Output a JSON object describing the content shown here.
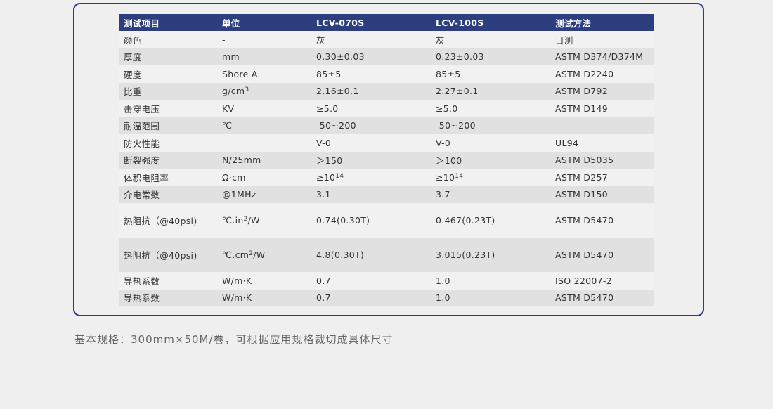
{
  "table": {
    "headers": [
      "测试项目",
      "单位",
      "LCV-070S",
      "LCV-100S",
      "测试方法"
    ],
    "rows": [
      {
        "item": "颜色",
        "unit": "-",
        "u_base": "",
        "u_sup": "",
        "u_tail": "",
        "v070": "灰",
        "v070_sup": "",
        "v100": "灰",
        "v100_sup": "",
        "method": "目测"
      },
      {
        "item": "厚度",
        "unit": "mm",
        "u_base": "",
        "u_sup": "",
        "u_tail": "",
        "v070": "0.30±0.03",
        "v070_sup": "",
        "v100": "0.23±0.03",
        "v100_sup": "",
        "method": "ASTM D374/D374M"
      },
      {
        "item": "硬度",
        "unit": "Shore A",
        "u_base": "",
        "u_sup": "",
        "u_tail": "",
        "v070": "85±5",
        "v070_sup": "",
        "v100": "85±5",
        "v100_sup": "",
        "method": "ASTM D2240"
      },
      {
        "item": "比重",
        "unit": "",
        "u_base": "g/cm",
        "u_sup": "3",
        "u_tail": "",
        "v070": "2.16±0.1",
        "v070_sup": "",
        "v100": "2.27±0.1",
        "v100_sup": "",
        "method": "ASTM D792"
      },
      {
        "item": "击穿电压",
        "unit": "KV",
        "u_base": "",
        "u_sup": "",
        "u_tail": "",
        "v070": "≥5.0",
        "v070_sup": "",
        "v100": "≥5.0",
        "v100_sup": "",
        "method": "ASTM D149"
      },
      {
        "item": "耐温范围",
        "unit": "℃",
        "u_base": "",
        "u_sup": "",
        "u_tail": "",
        "v070": "-50~200",
        "v070_sup": "",
        "v100": "-50~200",
        "v100_sup": "",
        "method": "-"
      },
      {
        "item": "防火性能",
        "unit": "",
        "u_base": "",
        "u_sup": "",
        "u_tail": "",
        "v070": "V-0",
        "v070_sup": "",
        "v100": "V-0",
        "v100_sup": "",
        "method": "UL94"
      },
      {
        "item": "断裂强度",
        "unit": "N/25mm",
        "u_base": "",
        "u_sup": "",
        "u_tail": "",
        "v070": "＞150",
        "v070_sup": "",
        "v100": "＞100",
        "v100_sup": "",
        "method": "ASTM D5035"
      },
      {
        "item": "体积电阻率",
        "unit": "Ω·cm",
        "u_base": "",
        "u_sup": "",
        "u_tail": "",
        "v070": "≥10",
        "v070_sup": "14",
        "v100": "≥10",
        "v100_sup": "14",
        "method": "ASTM D257"
      },
      {
        "item": "介电常数",
        "unit": "@1MHz",
        "u_base": "",
        "u_sup": "",
        "u_tail": "",
        "v070": "3.1",
        "v070_sup": "",
        "v100": "3.7",
        "v100_sup": "",
        "method": "ASTM D150"
      },
      {
        "item": "热阻抗（@40psi)",
        "unit": "",
        "u_base": "℃.in",
        "u_sup": "2",
        "u_tail": "/W",
        "v070": "0.74(0.30T)",
        "v070_sup": "",
        "v100": "0.467(0.23T)",
        "v100_sup": "",
        "method": "ASTM D5470"
      },
      {
        "item": "热阻抗（@40psi)",
        "unit": "",
        "u_base": "℃.cm",
        "u_sup": "2",
        "u_tail": "/W",
        "v070": "4.8(0.30T)",
        "v070_sup": "",
        "v100": "3.015(0.23T)",
        "v100_sup": "",
        "method": "ASTM D5470"
      },
      {
        "item": "导热系数",
        "unit": "W/m·K",
        "u_base": "",
        "u_sup": "",
        "u_tail": "",
        "v070": "0.7",
        "v070_sup": "",
        "v100": "1.0",
        "v100_sup": "",
        "method": "ISO 22007-2"
      },
      {
        "item": "导热系数",
        "unit": "W/m·K",
        "u_base": "",
        "u_sup": "",
        "u_tail": "",
        "v070": "0.7",
        "v070_sup": "",
        "v100": "1.0",
        "v100_sup": "",
        "method": "ASTM D5470"
      }
    ]
  },
  "footnote": "基本规格：300mm×50M/卷，可根据应用规格裁切成具体尺寸",
  "colors": {
    "header_bg": "#2c3e7e",
    "border": "#2d3a8c",
    "row_light": "#f1f1f1",
    "row_dark": "#e1e1e1"
  }
}
